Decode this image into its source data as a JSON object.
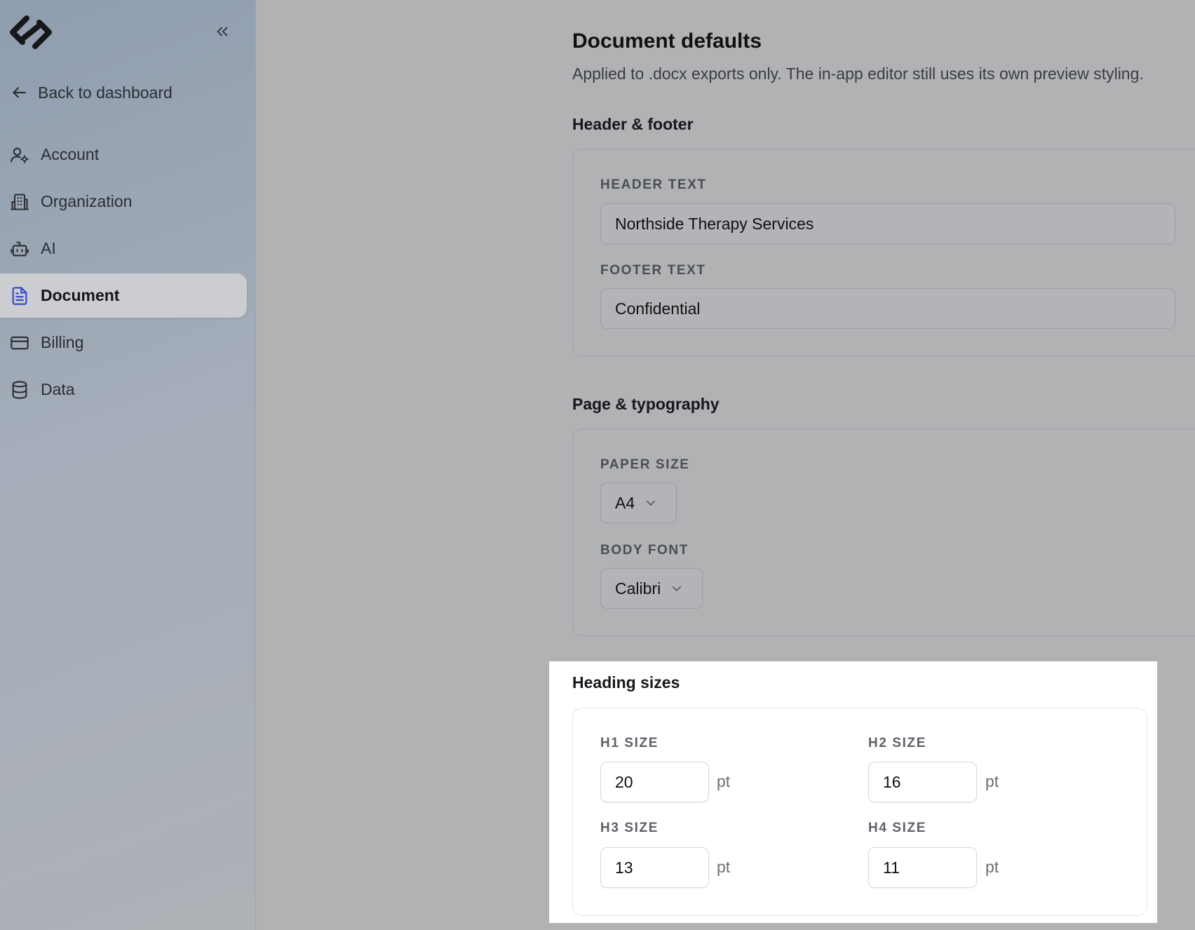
{
  "sidebar": {
    "back_label": "Back to dashboard",
    "items": [
      {
        "label": "Account",
        "icon": "user-gear-icon",
        "active": false
      },
      {
        "label": "Organization",
        "icon": "building-icon",
        "active": false
      },
      {
        "label": "AI",
        "icon": "robot-icon",
        "active": false
      },
      {
        "label": "Document",
        "icon": "document-icon",
        "active": true
      },
      {
        "label": "Billing",
        "icon": "credit-card-icon",
        "active": false
      },
      {
        "label": "Data",
        "icon": "database-icon",
        "active": false
      }
    ]
  },
  "page": {
    "title": "Document defaults",
    "subtitle": "Applied to .docx exports only. The in-app editor still uses its own preview styling."
  },
  "header_footer": {
    "title": "Header & footer",
    "header_label": "HEADER TEXT",
    "header_value": "Northside Therapy Services",
    "footer_label": "FOOTER TEXT",
    "footer_value": "Confidential"
  },
  "page_typography": {
    "title": "Page & typography",
    "paper_label": "PAPER SIZE",
    "paper_value": "A4",
    "font_label": "BODY FONT",
    "font_value": "Calibri"
  },
  "heading_sizes": {
    "title": "Heading sizes",
    "unit": "pt",
    "h1": {
      "label": "H1 SIZE",
      "value": "20"
    },
    "h2": {
      "label": "H2 SIZE",
      "value": "16"
    },
    "h3": {
      "label": "H3 SIZE",
      "value": "13"
    },
    "h4": {
      "label": "H4 SIZE",
      "value": "11"
    }
  },
  "colors": {
    "active_icon": "#3a4cc4",
    "highlight_bg": "#ffffff"
  }
}
